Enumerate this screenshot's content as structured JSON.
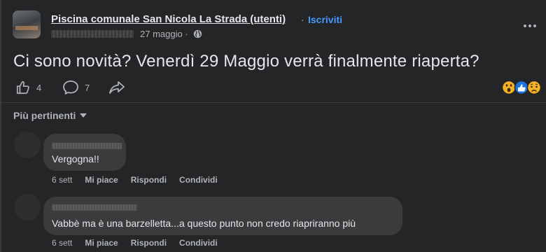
{
  "post": {
    "group_name": "Piscina comunale San Nicola La Strada (utenti)",
    "separator": "·",
    "join_label": "Iscriviti",
    "date": "27 maggio",
    "date_sep": "·",
    "text": "Ci sono novità? Venerdì 29 Maggio verrà finalmente riaperta?",
    "like_count": "4",
    "comment_count": "7",
    "reaction_icons": [
      "wow-reaction-icon",
      "like-reaction-icon",
      "sad-reaction-icon"
    ]
  },
  "comments_section": {
    "sort_label": "Più pertinenti",
    "comments": [
      {
        "text": "Vergogna!!",
        "time": "6 sett",
        "like_label": "Mi piace",
        "reply_label": "Rispondi",
        "share_label": "Condividi"
      },
      {
        "text": "Vabbè ma è una barzelletta...a questo punto non credo riapriranno più",
        "time": "6 sett",
        "like_label": "Mi piace",
        "reply_label": "Rispondi",
        "share_label": "Condividi"
      }
    ]
  },
  "colors": {
    "background": "#242526",
    "bubble": "#3a3b3c",
    "link": "#4599ff",
    "text": "#e4e6eb",
    "secondary_text": "#b0b3b8"
  }
}
